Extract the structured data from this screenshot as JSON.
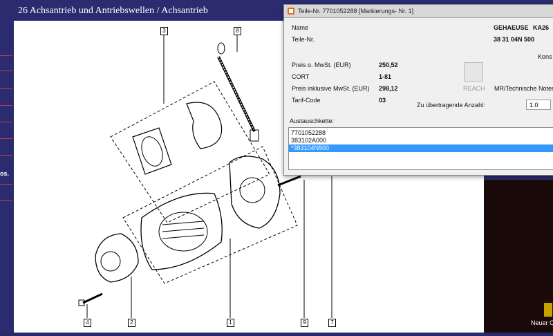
{
  "window": {
    "title": "26 Achsantrieb und Antriebswellen / Achsantrieb"
  },
  "left_nav": {
    "label": "os."
  },
  "diagram": {
    "callouts": [
      "3",
      "8",
      "4",
      "2",
      "1",
      "9",
      "7"
    ]
  },
  "dialog": {
    "title": "Teile-Nr. 7701052288 [Markierungs- Nr. 1]",
    "name_label": "Name",
    "name_value_1": "GEHAEUSE",
    "name_value_2": "KA26",
    "part_label": "Teile-Nr.",
    "part_value": "38 31 04N 500",
    "cut_label": "Kons",
    "price_label": "Preis o. MwSt. (EUR)",
    "price_value": "250,52",
    "cort_label": "CORT",
    "cort_value": "1-81",
    "price_incl_label": "Preis inklusive MwSt. (EUR)",
    "price_incl_value": "298,12",
    "tarif_label": "Tarif-Code",
    "tarif_value": "03",
    "reach_label": "REACH",
    "mr_label": "MR/Technische Noten",
    "qty_label": "Zu übertragende Anzahl:",
    "qty_value": "1.0",
    "exchange_label": "Austauschkette:",
    "exchange_items": [
      "7701052288",
      "383102A000",
      "*383104N500"
    ]
  },
  "desktop": {
    "icon_label": "Neuer O"
  }
}
